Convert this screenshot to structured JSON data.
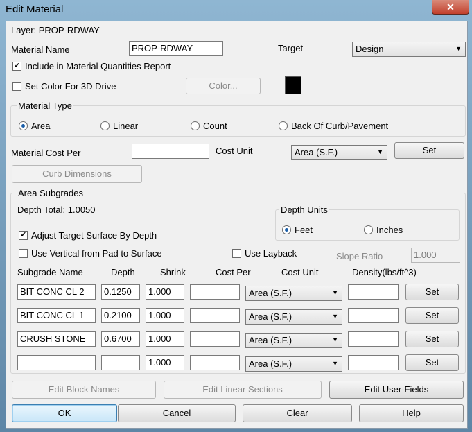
{
  "window": {
    "title": "Edit Material",
    "close_glyph": "✕"
  },
  "layer_label": "Layer: PROP-RDWAY",
  "material_name": {
    "label": "Material Name",
    "value": "PROP-RDWAY"
  },
  "target": {
    "label": "Target",
    "value": "Design"
  },
  "include_report": {
    "label": "Include in Material Quantities Report",
    "checked": true
  },
  "set_color": {
    "label": "Set Color For 3D Drive",
    "checked": false,
    "button": "Color...",
    "swatch_color": "#000000"
  },
  "material_type": {
    "title": "Material Type",
    "options": [
      "Area",
      "Linear",
      "Count",
      "Back Of Curb/Pavement"
    ],
    "selected": "Area"
  },
  "material_cost": {
    "label": "Material Cost Per",
    "value": "",
    "unit_label": "Cost Unit",
    "unit_value": "Area (S.F.)",
    "set_button": "Set"
  },
  "curb_dimensions_button": "Curb Dimensions",
  "subgrades": {
    "title": "Area Subgrades",
    "depth_total": "Depth Total: 1.0050",
    "adjust_target": {
      "label": "Adjust Target Surface By Depth",
      "checked": true
    },
    "use_vertical": {
      "label": "Use Vertical from Pad to Surface",
      "checked": false
    },
    "use_layback": {
      "label": "Use Layback",
      "checked": false
    },
    "slope_ratio": {
      "label": "Slope Ratio",
      "value": "1.000"
    },
    "depth_units": {
      "title": "Depth Units",
      "options": [
        "Feet",
        "Inches"
      ],
      "selected": "Feet"
    },
    "columns": [
      "Subgrade Name",
      "Depth",
      "Shrink",
      "Cost Per",
      "Cost Unit",
      "Density(lbs/ft^3)"
    ],
    "rows": [
      {
        "name": "BIT CONC CL 2",
        "depth": "0.1250",
        "shrink": "1.000",
        "cost": "",
        "unit": "Area (S.F.)",
        "density": "",
        "set": "Set"
      },
      {
        "name": "BIT CONC CL 1",
        "depth": "0.2100",
        "shrink": "1.000",
        "cost": "",
        "unit": "Area (S.F.)",
        "density": "",
        "set": "Set"
      },
      {
        "name": "CRUSH STONE",
        "depth": "0.6700",
        "shrink": "1.000",
        "cost": "",
        "unit": "Area (S.F.)",
        "density": "",
        "set": "Set"
      },
      {
        "name": "",
        "depth": "",
        "shrink": "1.000",
        "cost": "",
        "unit": "Area (S.F.)",
        "density": "",
        "set": "Set"
      }
    ]
  },
  "section_buttons": [
    "Edit Block Names",
    "Edit Linear Sections",
    "Edit User-Fields"
  ],
  "footer_buttons": [
    "OK",
    "Cancel",
    "Clear",
    "Help"
  ]
}
